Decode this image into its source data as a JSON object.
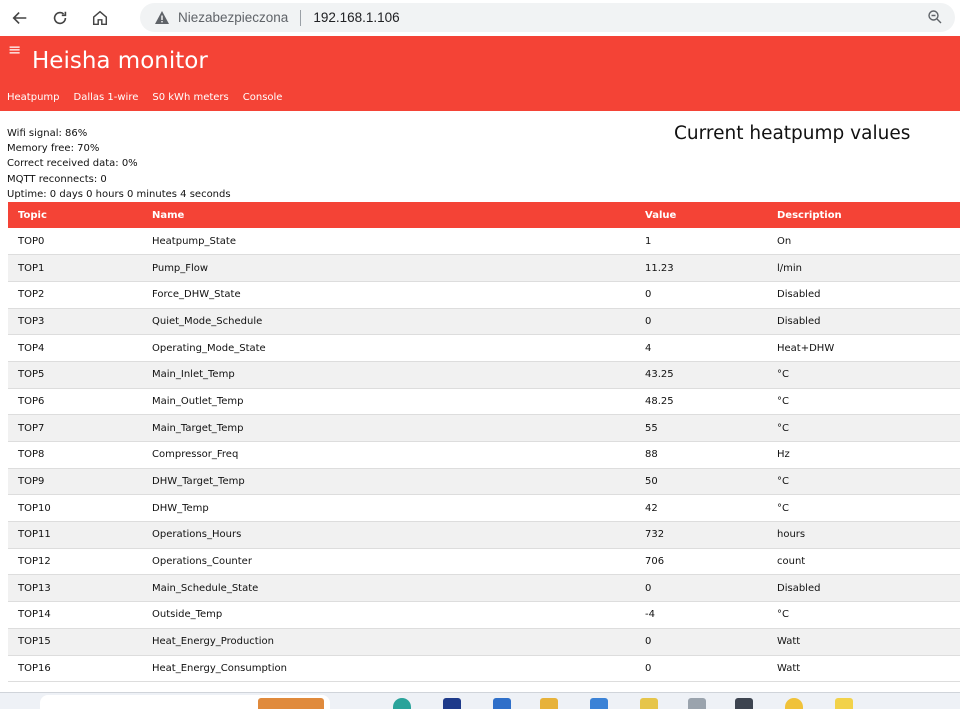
{
  "browser": {
    "security_label": "Niezabezpieczona",
    "url": "192.168.1.106",
    "icons": [
      "back-icon",
      "reload-icon",
      "home-icon",
      "warning-icon",
      "zoom-icon"
    ]
  },
  "app": {
    "title": "Heisha monitor",
    "menu_icon": "≡",
    "accent_color": "#f44336",
    "tabs": [
      "Heatpump",
      "Dallas 1-wire",
      "S0 kWh meters",
      "Console"
    ]
  },
  "status": {
    "wifi": "Wifi signal: 86%",
    "memory": "Memory free: 70%",
    "correct": "Correct received data: 0%",
    "mqtt": "MQTT reconnects: 0",
    "uptime": "Uptime: 0 days 0 hours 0 minutes 4 seconds"
  },
  "page_heading": "Current heatpump values",
  "table": {
    "headers": [
      "Topic",
      "Name",
      "Value",
      "Description"
    ],
    "rows": [
      [
        "TOP0",
        "Heatpump_State",
        "1",
        "On"
      ],
      [
        "TOP1",
        "Pump_Flow",
        "11.23",
        "l/min"
      ],
      [
        "TOP2",
        "Force_DHW_State",
        "0",
        "Disabled"
      ],
      [
        "TOP3",
        "Quiet_Mode_Schedule",
        "0",
        "Disabled"
      ],
      [
        "TOP4",
        "Operating_Mode_State",
        "4",
        "Heat+DHW"
      ],
      [
        "TOP5",
        "Main_Inlet_Temp",
        "43.25",
        "°C"
      ],
      [
        "TOP6",
        "Main_Outlet_Temp",
        "48.25",
        "°C"
      ],
      [
        "TOP7",
        "Main_Target_Temp",
        "55",
        "°C"
      ],
      [
        "TOP8",
        "Compressor_Freq",
        "88",
        "Hz"
      ],
      [
        "TOP9",
        "DHW_Target_Temp",
        "50",
        "°C"
      ],
      [
        "TOP10",
        "DHW_Temp",
        "42",
        "°C"
      ],
      [
        "TOP11",
        "Operations_Hours",
        "732",
        "hours"
      ],
      [
        "TOP12",
        "Operations_Counter",
        "706",
        "count"
      ],
      [
        "TOP13",
        "Main_Schedule_State",
        "0",
        "Disabled"
      ],
      [
        "TOP14",
        "Outside_Temp",
        "-4",
        "°C"
      ],
      [
        "TOP15",
        "Heat_Energy_Production",
        "0",
        "Watt"
      ],
      [
        "TOP16",
        "Heat_Energy_Consumption",
        "0",
        "Watt"
      ]
    ]
  }
}
